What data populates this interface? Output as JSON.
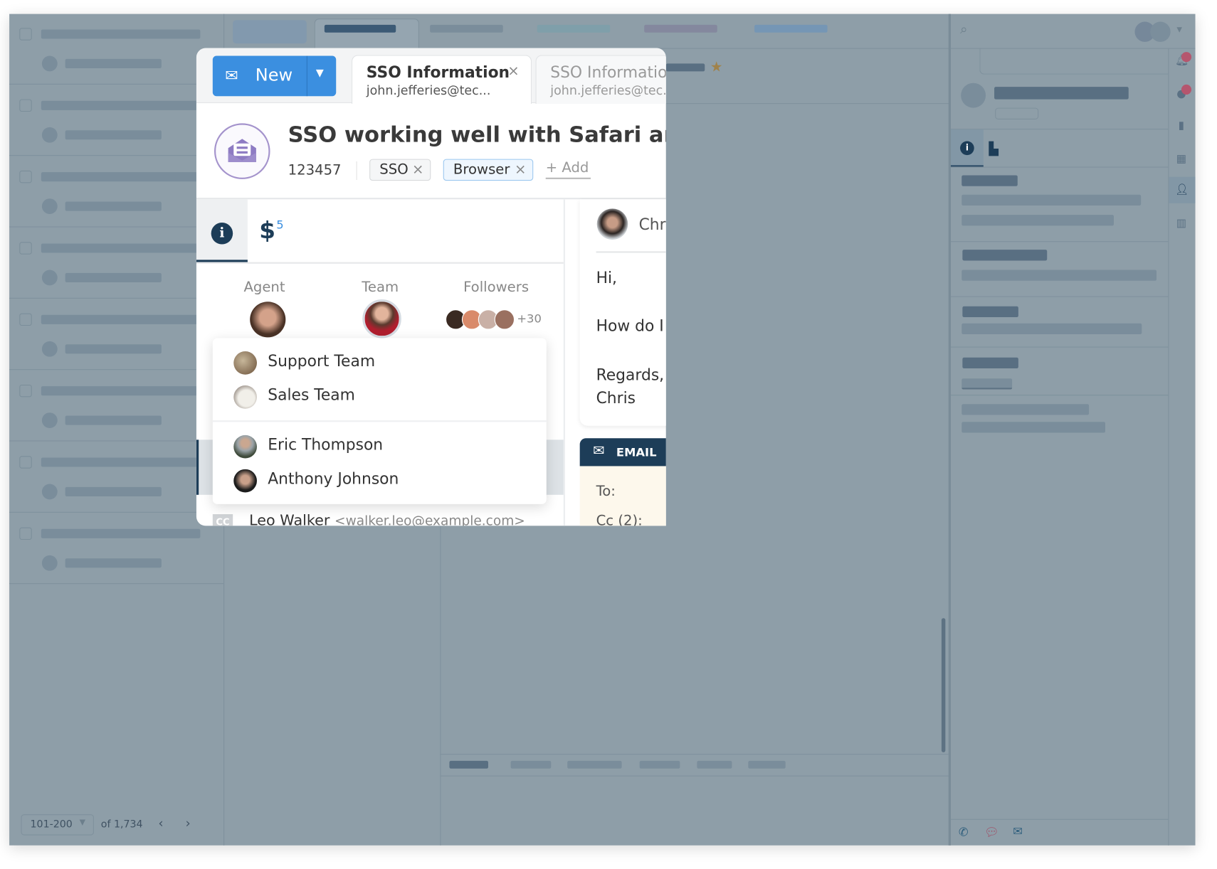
{
  "composer": {
    "new_label": "New",
    "tabs": [
      {
        "title": "SSO Information",
        "subtitle": "john.jefferies@tec...",
        "active": true
      },
      {
        "title": "SSO Information",
        "subtitle": "john.jefferies@tec...",
        "active": false
      }
    ]
  },
  "ticket": {
    "title": "SSO working well with Safari and IE",
    "id": "123457",
    "tags": [
      "SSO",
      "Browser"
    ],
    "add_tag_label": "+ Add",
    "icon": "envelope-open-icon",
    "icon_color": "#8e7cc3"
  },
  "details": {
    "billing_count": "5",
    "labels": {
      "agent": "Agent",
      "team": "Team",
      "followers": "Followers"
    },
    "followers_more": "+30"
  },
  "team_dropdown": {
    "groups": [
      [
        "Support Team",
        "Sales Team"
      ],
      [
        "Eric Thompson",
        "Anthony Johnson"
      ]
    ]
  },
  "cc_row": {
    "badge": "CC",
    "name": "Leo Walker",
    "email": "<walker.leo@example.com>"
  },
  "message": {
    "author": "Chris",
    "lines": [
      "Hi,",
      "How do I f",
      "Regards,",
      "Chris"
    ],
    "email_tab": "EMAIL",
    "to_label": "To:",
    "cc_label": "Cc (2):"
  },
  "pagination": {
    "range": "101-200",
    "total": "of 1,734"
  },
  "colors": {
    "accent": "#3b8fe0",
    "overlay": "#8e9ea8",
    "dark": "#1d3d58",
    "notification": "#b5566e"
  }
}
